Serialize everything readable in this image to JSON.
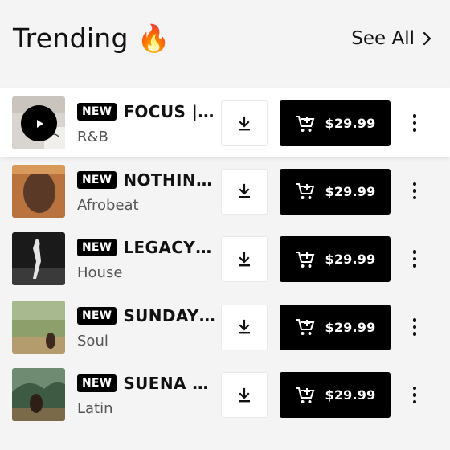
{
  "header": {
    "title": "Trending",
    "title_emoji": "🔥",
    "see_all": "See All"
  },
  "tracks": [
    {
      "badge": "NEW",
      "name": "FOCUS | ...",
      "genre": "R&B",
      "price": "$29.99",
      "playing": true
    },
    {
      "badge": "NEW",
      "name": "NOTHIN...",
      "genre": "Afrobeat",
      "price": "$29.99"
    },
    {
      "badge": "NEW",
      "name": "LEGACY |...",
      "genre": "House",
      "price": "$29.99"
    },
    {
      "badge": "NEW",
      "name": "SUNDAY ...",
      "genre": "Soul",
      "price": "$29.99"
    },
    {
      "badge": "NEW",
      "name": "SUENA SI...",
      "genre": "Latin",
      "price": "$29.99"
    }
  ],
  "colors": {
    "accent": "#000000",
    "background": "#f4f4f5",
    "row_active": "#ffffff"
  },
  "icons": [
    "play-icon",
    "download-icon",
    "add-to-cart-icon",
    "more-vertical-icon",
    "chevron-right-icon",
    "fire-emoji"
  ]
}
